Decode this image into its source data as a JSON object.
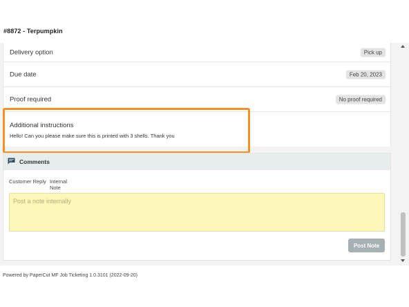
{
  "header": {
    "title": "#8872  -  Terpumpkin"
  },
  "details": {
    "delivery": {
      "label": "Delivery option",
      "value": "Pick up"
    },
    "due": {
      "label": "Due date",
      "value": "Feb 20, 2023"
    },
    "proof": {
      "label": "Proof required",
      "value": "No proof required"
    },
    "instructions": {
      "label": "Additional instructions",
      "text": "Hello! Can you please make sure this is printed with 3 shells. Thank you"
    }
  },
  "comments": {
    "icon": "comment-icon",
    "title": "Comments",
    "tabs": [
      {
        "label": "Customer Reply",
        "active": false
      },
      {
        "label": "Internal Note",
        "active": true
      }
    ],
    "placeholder": "Post a note internally",
    "value": "",
    "post_label": "Post Note"
  },
  "colors": {
    "highlight": "#f39122",
    "active_tab": "#47a36b",
    "note_bg": "#fdf7b9",
    "post_button": "#a5b1b3"
  },
  "footer": {
    "text": "Powered by PaperCut MF Job Ticketing 1.0.3101 (2022-09-20)"
  }
}
